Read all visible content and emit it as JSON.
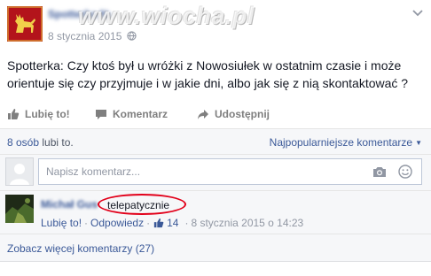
{
  "post": {
    "page_name": "Spotterka Nowosiułek",
    "date": "8 stycznia 2015",
    "watermark": "www.wiocha.pl",
    "text": "Spotterka: Czy ktoś był u wróżki z Nowosiułek w ostatnim czasie i może orientuje się czy przyjmuje i w jakie dni, albo jak się z nią skontaktować ?"
  },
  "actions": {
    "like": "Lubię to!",
    "comment": "Komentarz",
    "share": "Udostępnij"
  },
  "likes": {
    "count": "8 osób",
    "suffix": "lubi to.",
    "sort_label": "Najpopularniejsze komentarze"
  },
  "composer": {
    "placeholder": "Napisz komentarz..."
  },
  "comments": [
    {
      "author": "Michał Gusz",
      "text": "telepatycznie",
      "like_label": "Lubię to!",
      "reply_label": "Odpowiedz",
      "likes": "14",
      "timestamp": "8 stycznia 2015 o 14:23"
    }
  ],
  "more_comments": "Zobacz więcej komentarzy (27)",
  "colors": {
    "link": "#3b5998",
    "muted": "#9197a3",
    "highlight_ellipse": "#e2001a",
    "avatar_bg": "#b3141b"
  },
  "icons": {
    "avatar": "deer-emblem",
    "privacy": "globe-icon",
    "menu": "chevron-down-icon",
    "like": "thumbs-up-icon",
    "comment": "speech-bubble-icon",
    "share": "share-arrow-icon",
    "photo": "camera-icon",
    "emoji": "smiley-icon"
  }
}
